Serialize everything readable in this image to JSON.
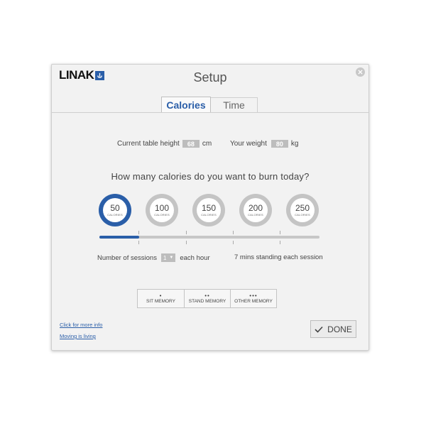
{
  "app": {
    "logo": "LINAK",
    "title": "Setup"
  },
  "tabs": [
    {
      "label": "Calories",
      "active": true
    },
    {
      "label": "Time",
      "active": false
    }
  ],
  "info": {
    "table_height_label": "Current table height",
    "table_height_value": "68",
    "table_height_unit": "cm",
    "weight_label": "Your weight",
    "weight_value": "80",
    "weight_unit": "kg"
  },
  "question": "How many calories do you want to burn today?",
  "calorie_options": [
    {
      "value": "50",
      "unit": "CALORIES",
      "selected": true
    },
    {
      "value": "100",
      "unit": "CALORIES",
      "selected": false
    },
    {
      "value": "150",
      "unit": "CALORIES",
      "selected": false
    },
    {
      "value": "200",
      "unit": "CALORIES",
      "selected": false
    },
    {
      "value": "250",
      "unit": "CALORIES",
      "selected": false
    }
  ],
  "slider": {
    "fraction": 0.18
  },
  "sessions": {
    "label": "Number of sessions",
    "value": "1",
    "suffix": "each hour",
    "standing_text": "7 mins standing each session"
  },
  "memory": [
    {
      "dots": "•",
      "label": "SIT MEMORY"
    },
    {
      "dots": "••",
      "label": "STAND MEMORY"
    },
    {
      "dots": "•••",
      "label": "OTHER MEMORY"
    }
  ],
  "links": {
    "more_info": "Click for more info",
    "moving": "Moving is living"
  },
  "done_label": "DONE",
  "colors": {
    "accent": "#2a5ea8",
    "ring": "#c4c4c4",
    "panel": "#f2f2f2"
  },
  "icons": {
    "close": "close-icon",
    "check": "check-icon"
  }
}
